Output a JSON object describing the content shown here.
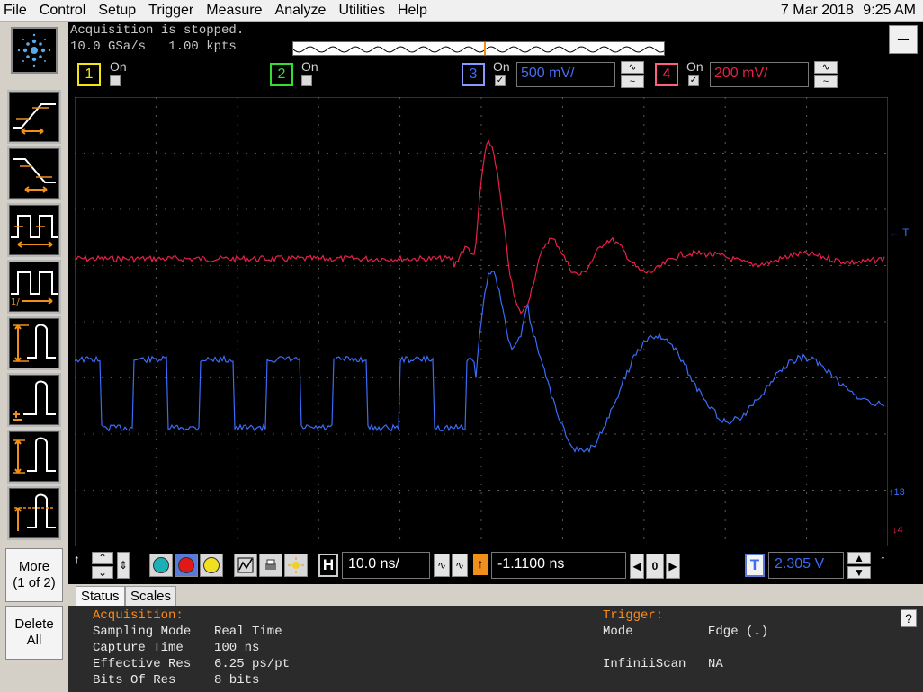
{
  "menu": [
    "File",
    "Control",
    "Setup",
    "Trigger",
    "Measure",
    "Analyze",
    "Utilities",
    "Help"
  ],
  "clock": {
    "date": "7 Mar 2018",
    "time": "9:25 AM"
  },
  "acquisition": {
    "status": "Acquisition is stopped.",
    "rate": "10.0 GSa/s   1.00 kpts"
  },
  "minimize_label": "—",
  "channels": [
    {
      "num": "1",
      "on_label": "On",
      "checked": false,
      "color": "#f2e60f",
      "scale": ""
    },
    {
      "num": "2",
      "on_label": "On",
      "checked": false,
      "color": "#33dd33",
      "scale": ""
    },
    {
      "num": "3",
      "on_label": "On",
      "checked": true,
      "color": "#3a5ce8",
      "scale": "500 mV/"
    },
    {
      "num": "4",
      "on_label": "On",
      "checked": true,
      "color": "#e8204a",
      "scale": "200 mV/"
    }
  ],
  "side_buttons": {
    "more_line1": "More",
    "more_line2": "(1 of 2)",
    "delete_line1": "Delete",
    "delete_line2": "All"
  },
  "timebase": {
    "scale": "10.0 ns/",
    "position": "-1.1100 ns",
    "h_label": "H",
    "zero_label": "0"
  },
  "trigger_level": {
    "label": "T",
    "value": "2.305 V"
  },
  "markers": {
    "trigger_right": "← T",
    "ch3_marker": "↑13",
    "ch4_marker": "↓4"
  },
  "tabs": [
    "Status",
    "Scales"
  ],
  "status": {
    "acq_heading": "Acquisition:",
    "rows": [
      {
        "label": "Sampling Mode",
        "value": "Real Time"
      },
      {
        "label": "Capture Time",
        "value": "100 ns"
      },
      {
        "label": "Effective Res",
        "value": "6.25 ps/pt"
      },
      {
        "label": "Bits Of Res",
        "value": "8 bits"
      }
    ],
    "trig_heading": "Trigger:",
    "trig_rows": [
      {
        "label": "Mode",
        "value": "Edge (↓)"
      },
      {
        "label": "InfiniiScan",
        "value": "NA"
      }
    ]
  },
  "help_label": "?"
}
